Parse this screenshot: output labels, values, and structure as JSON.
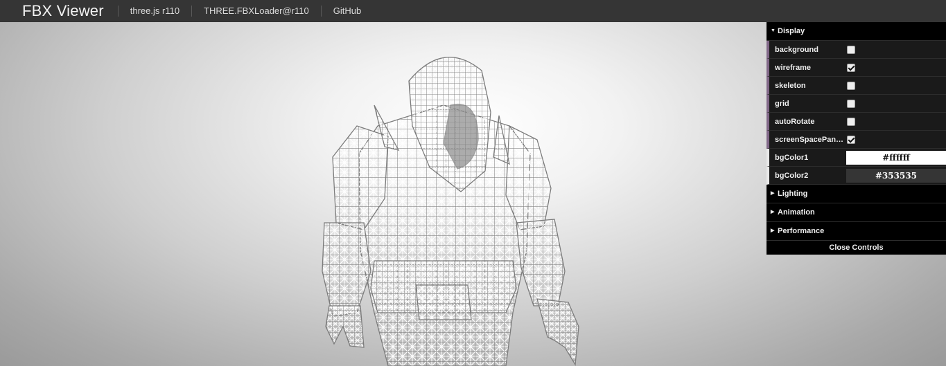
{
  "nav": {
    "brand": "FBX Viewer",
    "links": [
      "three.js r110",
      "THREE.FBXLoader@r110",
      "GitHub"
    ]
  },
  "colors": {
    "topbar": "#353535",
    "gui_bg": "#1a1a1a",
    "folder_bg": "#000000",
    "accent": "#806787"
  },
  "gui": {
    "display_folder": "Display",
    "controls": [
      {
        "label": "background",
        "checked": false
      },
      {
        "label": "wireframe",
        "checked": true
      },
      {
        "label": "skeleton",
        "checked": false
      },
      {
        "label": "grid",
        "checked": false
      },
      {
        "label": "autoRotate",
        "checked": false
      },
      {
        "label": "screenSpacePan…",
        "checked": true
      }
    ],
    "bgColor1": {
      "label": "bgColor1",
      "value": "#ffffff"
    },
    "bgColor2": {
      "label": "bgColor2",
      "value": "#353535"
    },
    "folders": [
      "Lighting",
      "Animation",
      "Performance"
    ],
    "close_label": "Close Controls"
  }
}
